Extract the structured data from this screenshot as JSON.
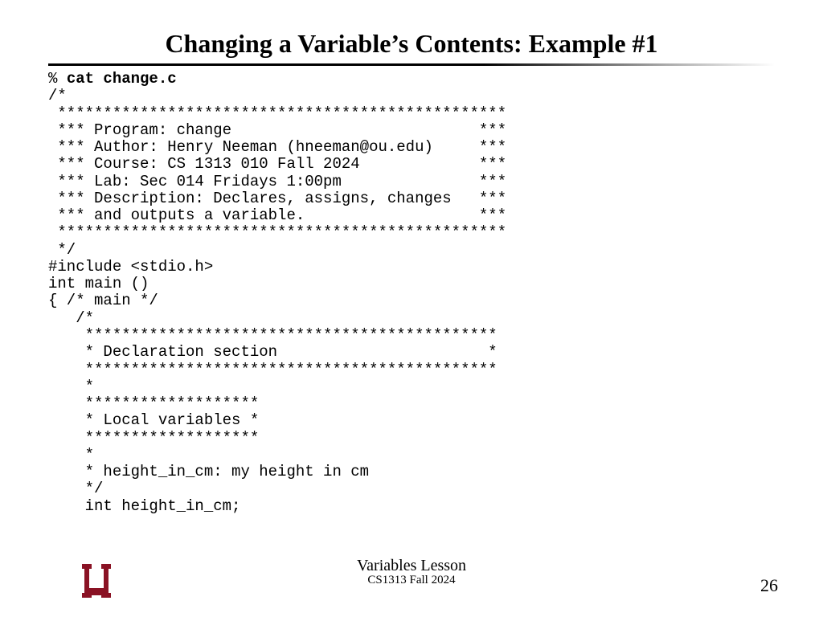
{
  "title": "Changing a Variable’s Contents: Example #1",
  "code": {
    "prompt": "% ",
    "command": "cat change.c",
    "body": "/*\n *************************************************\n *** Program: change                           ***\n *** Author: Henry Neeman (hneeman@ou.edu)     ***\n *** Course: CS 1313 010 Fall 2024             ***\n *** Lab: Sec 014 Fridays 1:00pm               ***\n *** Description: Declares, assigns, changes   ***\n *** and outputs a variable.                   ***\n *************************************************\n */\n#include <stdio.h>\nint main ()\n{ /* main */\n   /*\n    *********************************************\n    * Declaration section                       *\n    *********************************************\n    *\n    *******************\n    * Local variables *\n    *******************\n    *\n    * height_in_cm: my height in cm\n    */\n    int height_in_cm;"
  },
  "footer": {
    "lesson": "Variables Lesson",
    "course": "CS1313 Fall 2024",
    "page": "26"
  },
  "logo": {
    "name": "ou-logo",
    "color": "#8a1224"
  }
}
